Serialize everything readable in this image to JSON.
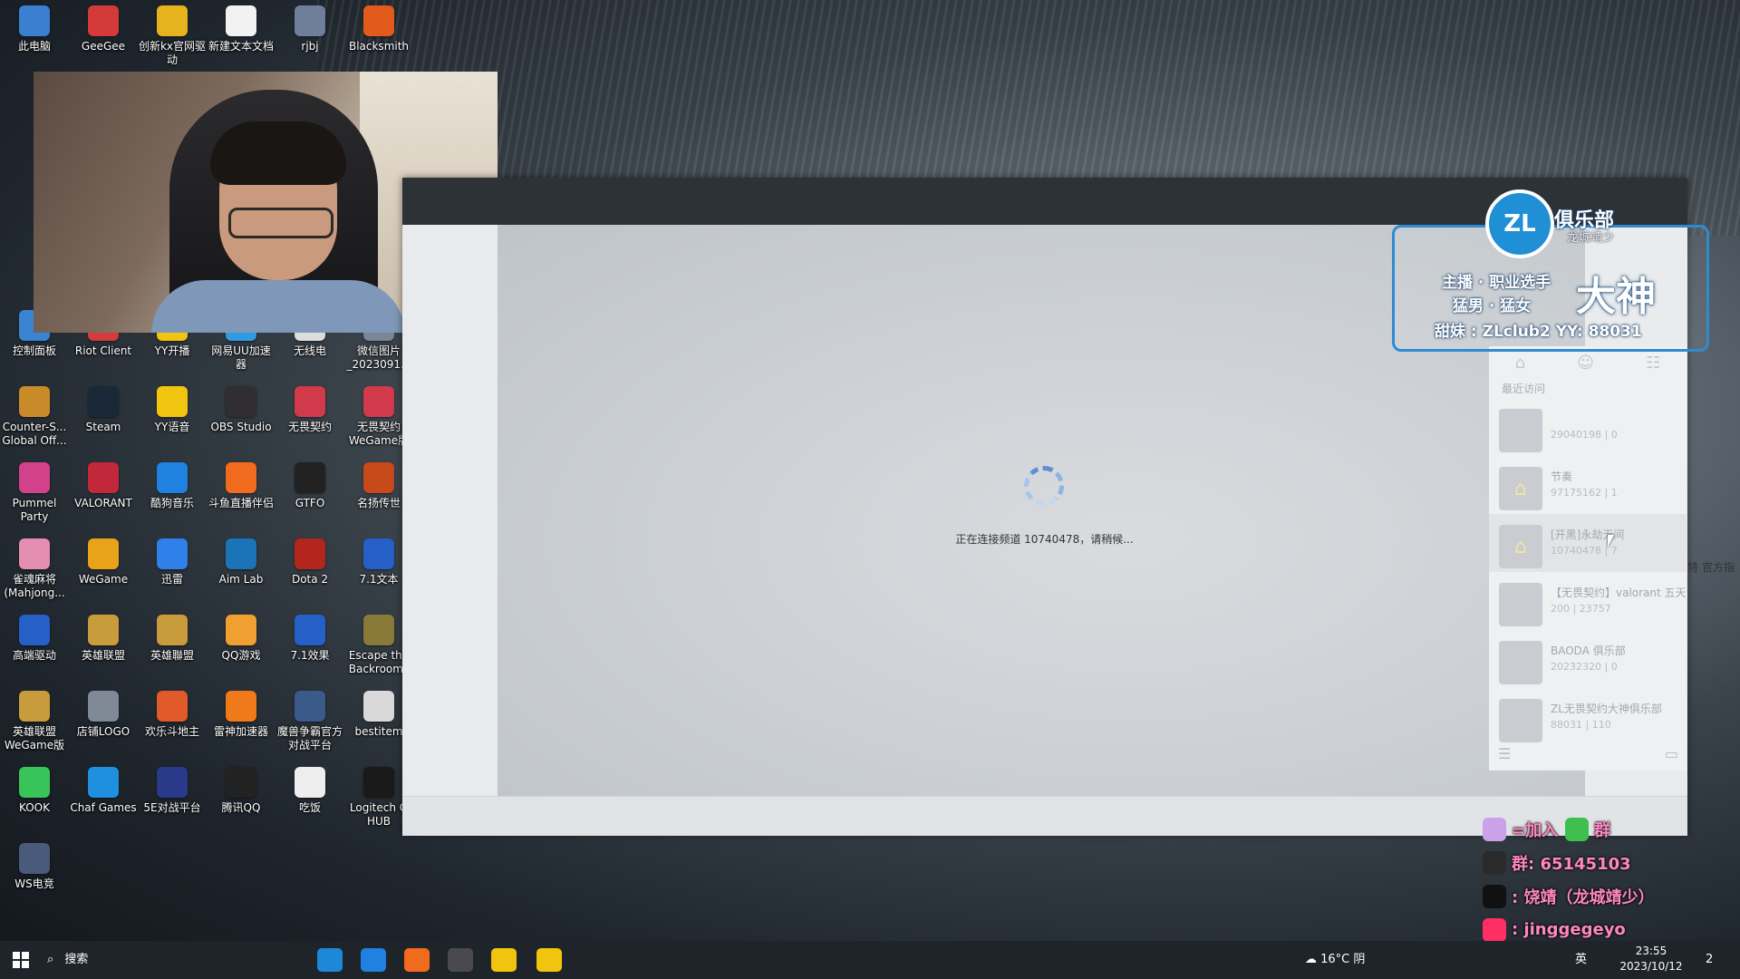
{
  "desktop": {
    "icons": [
      {
        "label": "此电脑",
        "color": "#3b7fd1"
      },
      {
        "label": "GeeGee",
        "color": "#d43a3a"
      },
      {
        "label": "创新kx官网驱动",
        "color": "#e6b31e"
      },
      {
        "label": "新建文本文档",
        "color": "#f2f2f2"
      },
      {
        "label": "rjbj",
        "color": "#6f7f9a"
      },
      {
        "label": "Blacksmith",
        "color": "#e25a1c"
      },
      {
        "label": "控制面板",
        "color": "#3a84d4"
      },
      {
        "label": "Riot Client",
        "color": "#d13c3c"
      },
      {
        "label": "YY开播",
        "color": "#f1c40f"
      },
      {
        "label": "网易UU加速器",
        "color": "#2f9be0"
      },
      {
        "label": "无线电",
        "color": "#dddddd"
      },
      {
        "label": "微信图片_2023091...",
        "color": "#7a8796"
      },
      {
        "label": "Counter-S... Global Off...",
        "color": "#c98b2a"
      },
      {
        "label": "Steam",
        "color": "#1b2838"
      },
      {
        "label": "YY语音",
        "color": "#f1c40f"
      },
      {
        "label": "OBS Studio",
        "color": "#302e31"
      },
      {
        "label": "无畏契约",
        "color": "#d13a4a"
      },
      {
        "label": "无畏契约 WeGame版",
        "color": "#d13a4a"
      },
      {
        "label": "Pummel Party",
        "color": "#d1428b"
      },
      {
        "label": "VALORANT",
        "color": "#c1293a"
      },
      {
        "label": "酷狗音乐",
        "color": "#1f82e0"
      },
      {
        "label": "斗鱼直播伴侣",
        "color": "#f06b1d"
      },
      {
        "label": "GTFO",
        "color": "#222222"
      },
      {
        "label": "名扬传世",
        "color": "#c64a1a"
      },
      {
        "label": "雀魂麻将(Mahjong...",
        "color": "#e48fb2"
      },
      {
        "label": "WeGame",
        "color": "#e8a31a"
      },
      {
        "label": "迅雷",
        "color": "#2f80e8"
      },
      {
        "label": "Aim Lab",
        "color": "#1b74b8"
      },
      {
        "label": "Dota 2",
        "color": "#b3261e"
      },
      {
        "label": "7.1文本",
        "color": "#2660c7"
      },
      {
        "label": "高端驱动",
        "color": "#2660c7"
      },
      {
        "label": "英雄联盟",
        "color": "#c89b3c"
      },
      {
        "label": "英雄聯盟",
        "color": "#c89b3c"
      },
      {
        "label": "QQ游戏",
        "color": "#f0a030"
      },
      {
        "label": "7.1效果",
        "color": "#2660c7"
      },
      {
        "label": "Escape the Backrooms",
        "color": "#8a7a3a"
      },
      {
        "label": "英雄联盟 WeGame版",
        "color": "#c89b3c"
      },
      {
        "label": "店铺LOGO",
        "color": "#7f8a96"
      },
      {
        "label": "欢乐斗地主",
        "color": "#e05a2a"
      },
      {
        "label": "雷神加速器",
        "color": "#f07a1a"
      },
      {
        "label": "魔兽争霸官方对战平台",
        "color": "#3a5a8a"
      },
      {
        "label": "bestitem",
        "color": "#d9d9d9"
      },
      {
        "label": "KOOK",
        "color": "#39c45a"
      },
      {
        "label": "Chaf Games",
        "color": "#1f8fe0"
      },
      {
        "label": "5E对战平台",
        "color": "#2a3a8a"
      },
      {
        "label": "腾讯QQ",
        "color": "#222222"
      },
      {
        "label": "吃饭",
        "color": "#eeeeee"
      },
      {
        "label": "Logitech G HUB",
        "color": "#1a1a1a"
      },
      {
        "label": "WS电竞",
        "color": "#4a5a7a"
      }
    ]
  },
  "client": {
    "loading_text": "正在连接频道 10740478，请稍候...",
    "panel": {
      "recent_label": "最近访问",
      "rows": [
        {
          "name": "",
          "sub": "29040198 | 0",
          "icon": "avatar-icon"
        },
        {
          "name": "节奏",
          "sub": "97175162 | 1",
          "icon": "house-icon"
        },
        {
          "name": "[开黑]永劫无间",
          "sub": "10740478 | 7",
          "icon": "house-icon"
        },
        {
          "name": "【无畏契约】valorant 五天",
          "sub": "200 | 23757",
          "icon": "pop-icon"
        },
        {
          "name": "BAODA 俱乐部",
          "sub": "20232320 | 0",
          "icon": "avatar-icon"
        },
        {
          "name": "ZL无畏契约大神俱乐部",
          "sub": "88031 | 110",
          "icon": "logo-icon"
        }
      ],
      "overflow_text": "特 官方指"
    }
  },
  "overlay": {
    "club_name": "俱乐部",
    "club_sub": "龙城靖少",
    "logo_text": "ZL",
    "line1": "主播 · 职业选手",
    "line2": "猛男 · 猛女",
    "big": "大神",
    "line3": "甜妹 : ZLclub2    YY: 88031",
    "join": "=加入",
    "join_suffix": "群",
    "qq": "群: 65145103",
    "douyin": ": 饶靖（龙城靖少）",
    "xiaohongshu": ": jinggegeyo"
  },
  "taskbar": {
    "search_placeholder": "搜索",
    "weather": "16°C 阴",
    "ime": "英",
    "time": "23:55",
    "date": "2023/10/12",
    "notifications": "2"
  },
  "colors": {
    "accent": "#2f8bd1",
    "pink": "#ff87c1",
    "spinner": "#5d8fd4"
  }
}
